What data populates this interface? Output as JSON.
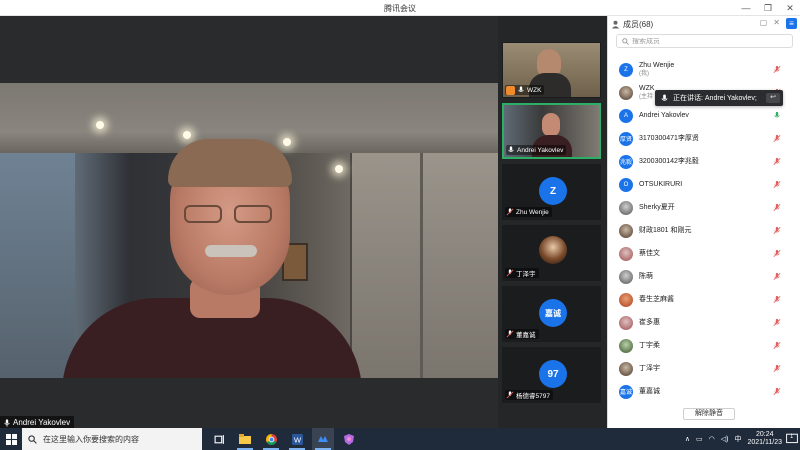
{
  "window": {
    "title": "腾讯会议",
    "controls": [
      "—",
      "❐",
      "✕"
    ]
  },
  "main_video": {
    "speaker_name": "Andrei Yakovlev"
  },
  "thumbnails": [
    {
      "name": "WZK",
      "type": "video",
      "host": true
    },
    {
      "name": "Andrei Yakovlev",
      "type": "video",
      "active": true
    },
    {
      "name": "Zhu Wenjie",
      "type": "avatar",
      "avatar_text": "Z"
    },
    {
      "name": "丁泽宇",
      "type": "photo"
    },
    {
      "name": "董嘉诚",
      "type": "avatar",
      "avatar_text": "嘉诚"
    },
    {
      "name": "杨德睿5797",
      "type": "avatar",
      "avatar_text": "97"
    }
  ],
  "members": {
    "title": "成员(68)",
    "search_placeholder": "搜索成员",
    "speaking_toast": "正在讲话: Andrei Yakovlev;",
    "list": [
      {
        "name": "Zhu Wenjie",
        "sub": "(我)",
        "avatar_text": "Z",
        "mic": "muted"
      },
      {
        "name": "WZK",
        "sub": "(主持",
        "avatar_text": "",
        "avatar_style": "img",
        "mic": "muted"
      },
      {
        "name": "Andrei Yakovlev",
        "sub": "",
        "avatar_text": "A",
        "mic": "on"
      },
      {
        "name": "3170300471李厚贤",
        "sub": "",
        "avatar_text": "厚贤",
        "mic": "muted"
      },
      {
        "name": "3200300142李兆毅",
        "sub": "",
        "avatar_text": "兆毅",
        "mic": "muted"
      },
      {
        "name": "OTSUKIRURI",
        "sub": "",
        "avatar_text": "O",
        "mic": "muted"
      },
      {
        "name": "Sherky夏开",
        "sub": "",
        "avatar_text": "",
        "avatar_style": "img5",
        "mic": "muted"
      },
      {
        "name": "财政1801 和刚元",
        "sub": "",
        "avatar_text": "",
        "avatar_style": "img",
        "mic": "muted"
      },
      {
        "name": "蔡佳文",
        "sub": "",
        "avatar_text": "",
        "avatar_style": "img2",
        "mic": "muted"
      },
      {
        "name": "陈萌",
        "sub": "",
        "avatar_text": "",
        "avatar_style": "img5",
        "mic": "muted"
      },
      {
        "name": "春生芝麻酱",
        "sub": "",
        "avatar_text": "",
        "avatar_style": "img4",
        "mic": "muted"
      },
      {
        "name": "崔多惠",
        "sub": "",
        "avatar_text": "",
        "avatar_style": "img2",
        "mic": "muted"
      },
      {
        "name": "丁宇柔",
        "sub": "",
        "avatar_text": "",
        "avatar_style": "img3",
        "mic": "muted"
      },
      {
        "name": "丁泽宇",
        "sub": "",
        "avatar_text": "",
        "avatar_style": "img",
        "mic": "muted"
      },
      {
        "name": "董嘉诚",
        "sub": "",
        "avatar_text": "嘉诚",
        "mic": "muted"
      }
    ],
    "unmute_all_label": "解除静音"
  },
  "taskbar": {
    "search_placeholder": "在这里输入你要搜索的内容",
    "time": "20:24",
    "date": "2021/11/23",
    "ime": "中",
    "notification_count": "1"
  },
  "colors": {
    "accent": "#1a73e8",
    "active_border": "#2cae66",
    "muted_mic": "#e06060",
    "taskbar": "#1f2a3a"
  }
}
